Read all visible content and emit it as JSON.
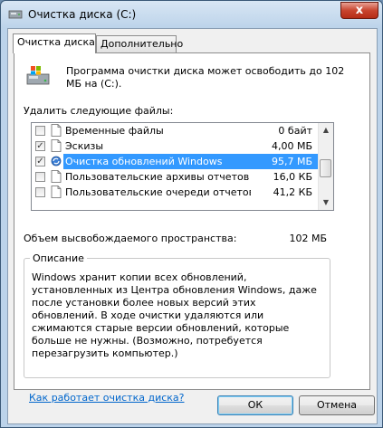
{
  "window": {
    "title": "Очистка диска  (C:)",
    "close_label": "x"
  },
  "tabs": [
    {
      "label": "Очистка диска"
    },
    {
      "label": "Дополнительно"
    }
  ],
  "summary_text": "Программа очистки диска может освободить до 102 МБ на  (C:).",
  "files_label": "Удалить следующие файлы:",
  "files": [
    {
      "checked": false,
      "name": "Временные файлы",
      "size": "0 байт",
      "icon": "file-icon"
    },
    {
      "checked": true,
      "name": "Эскизы",
      "size": "4,00 МБ",
      "icon": "file-icon"
    },
    {
      "checked": true,
      "name": "Очистка обновлений Windows",
      "size": "95,7 МБ",
      "icon": "windows-update-icon",
      "selected": true
    },
    {
      "checked": false,
      "name": "Пользовательские архивы отчетов ...",
      "size": "16,0 КБ",
      "icon": "file-icon"
    },
    {
      "checked": false,
      "name": "Пользовательские очереди отчетов...",
      "size": "41,2 КБ",
      "icon": "file-icon"
    }
  ],
  "space_label": "Объем высвобождаемого пространства:",
  "space_value": "102 МБ",
  "description": {
    "title": "Описание",
    "text": "Windows хранит копии всех обновлений, установленных из Центра обновления Windows, даже после установки более новых версий этих обновлений. В ходе очистки удаляются или сжимаются старые версии обновлений, которые больше не нужны. (Возможно, потребуется перезагрузить компьютер.)"
  },
  "help_link": "Как работает очистка диска?",
  "buttons": {
    "ok": "ОК",
    "cancel": "Отмена"
  },
  "colors": {
    "selection": "#3399ff",
    "link": "#0066cc",
    "close": "#c8452f"
  }
}
